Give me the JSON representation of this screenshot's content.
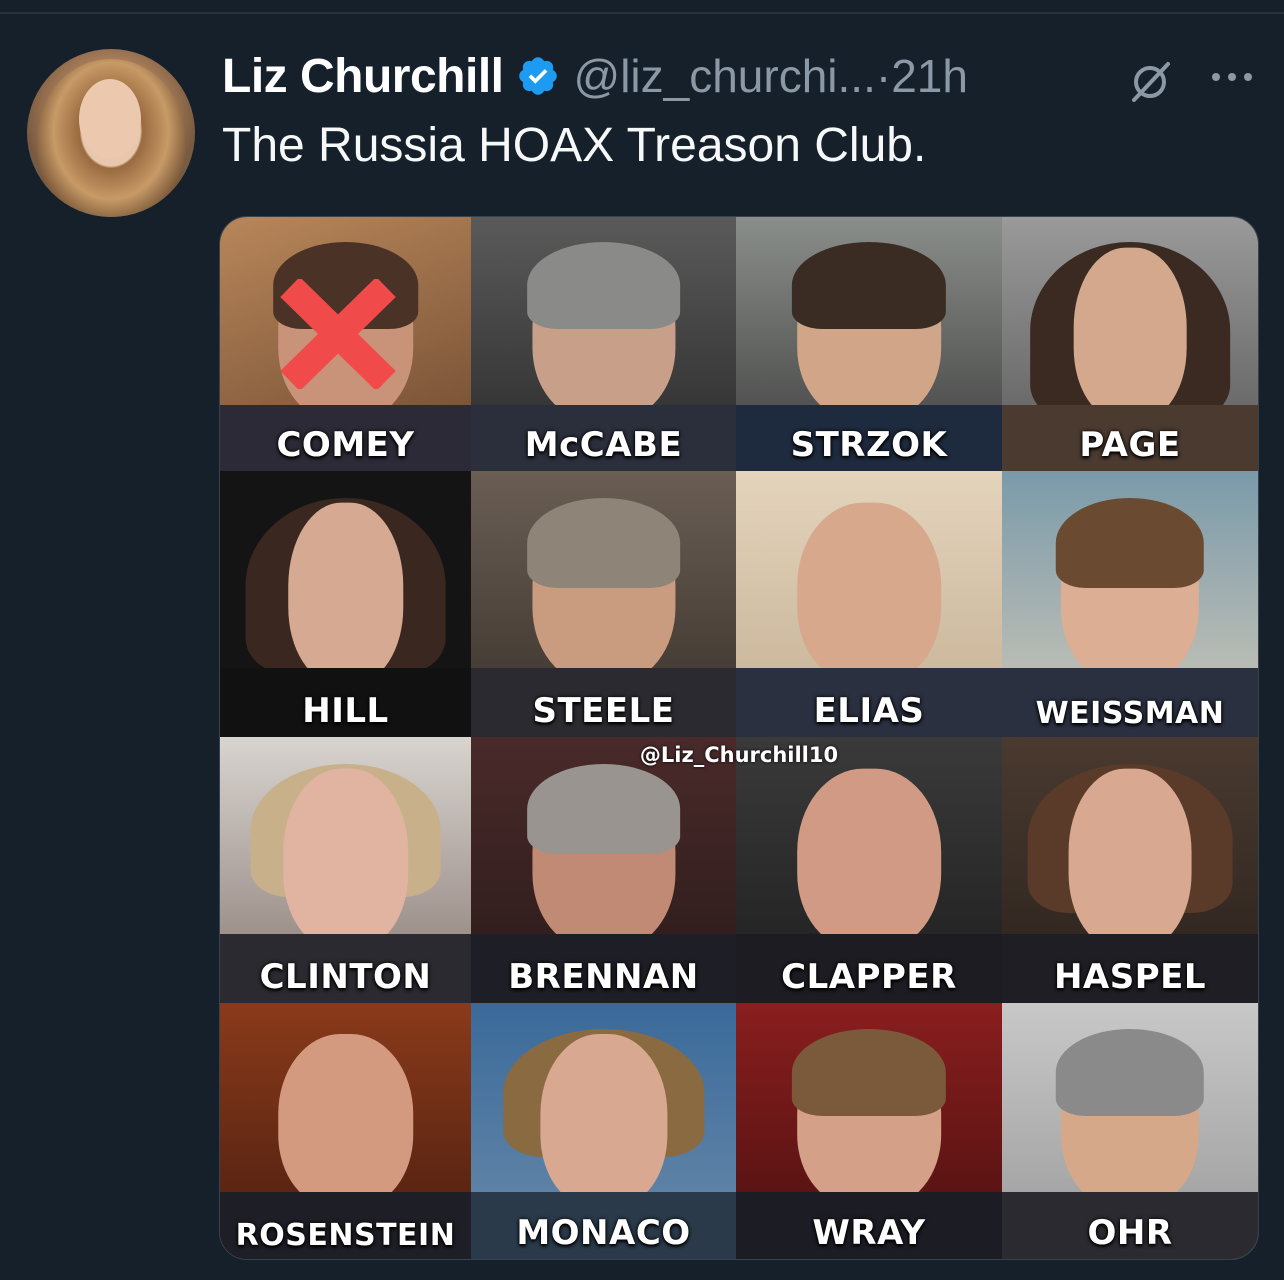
{
  "tweet": {
    "author_name": "Liz Churchill",
    "handle": "@liz_churchi...",
    "separator": "·",
    "time": "21h",
    "text": "The Russia HOAX Treason Club."
  },
  "colors": {
    "background": "#15202b",
    "verified_badge": "#1d9bf0",
    "secondary_text": "#8b98a5",
    "x_mark": "#f04a4a"
  },
  "icons": {
    "verified": "verified-badge-icon",
    "grok": "grok-icon",
    "more": "more-options-icon"
  },
  "image": {
    "watermark": "@Liz_Churchill10",
    "labels": [
      "COMEY",
      "McCABE",
      "STRZOK",
      "PAGE",
      "HILL",
      "STEELE",
      "ELIAS",
      "WEISSMAN",
      "CLINTON",
      "BRENNAN",
      "CLAPPER",
      "HASPEL",
      "ROSENSTEIN",
      "MONACO",
      "WRAY",
      "OHR"
    ]
  }
}
